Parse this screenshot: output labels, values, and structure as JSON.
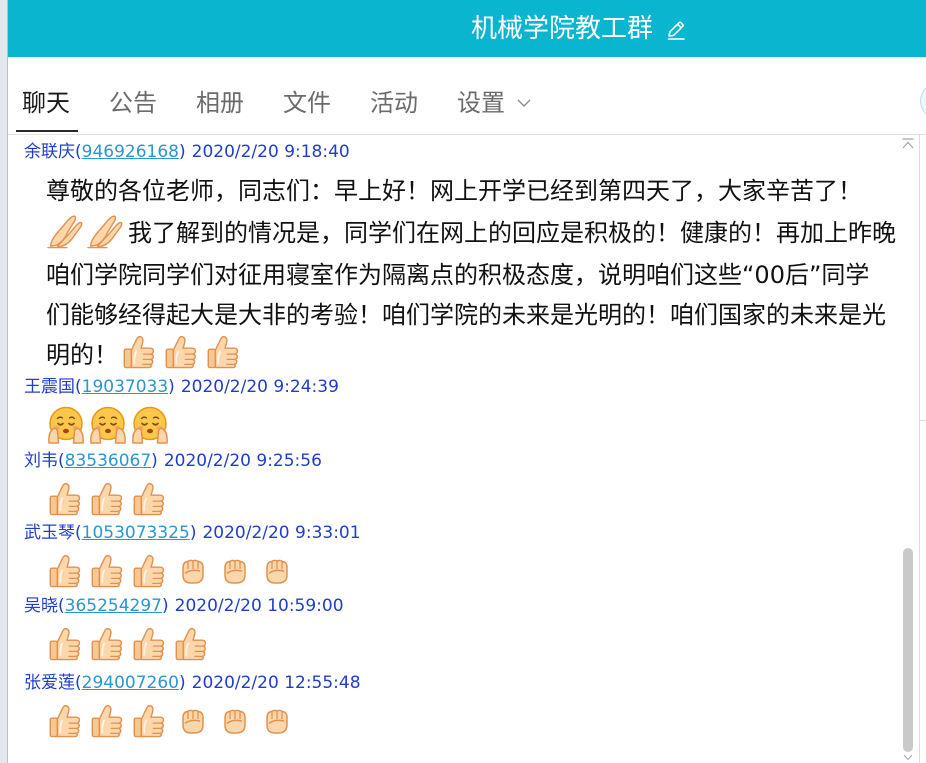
{
  "window": {
    "title": "机械学院教工群"
  },
  "icons": {
    "title_edit": "pencil-icon",
    "settings_menu": "chevron-down-icon",
    "panel_collapse": "collapse-up-icon",
    "scroll_down": "chevron-down-icon"
  },
  "colors": {
    "header_bg": "#0ab5cf",
    "name": "#1f3ecb",
    "qq_link": "#2b96d4",
    "message_text": "#111111",
    "tab_active": "#1a1a1a",
    "tab_inactive": "#6b6b6b",
    "scroll_thumb": "#c9c9c9"
  },
  "tabs": [
    {
      "label": "聊天",
      "active": true
    },
    {
      "label": "公告"
    },
    {
      "label": "相册"
    },
    {
      "label": "文件"
    },
    {
      "label": "活动"
    },
    {
      "label": "设置",
      "has_dropdown": true
    }
  ],
  "messages": [
    {
      "sender": "余联庆",
      "qq": "946926168",
      "time": "2020/2/20 9:18:40",
      "lines": [
        {
          "text": "尊敬的各位老师，同志们：早上好！网上开学已经到第四天了，大家辛苦了！"
        },
        {
          "emoji_before": [
            "pray-hands",
            "pray-hands"
          ],
          "text": "我了解到的情况是，同学们在网上的回应是积极的！健康的！再加上昨晚"
        },
        {
          "text": "咱们学院同学们对征用寝室作为隔离点的积极态度，说明咱们这些“00后”同学"
        },
        {
          "text": "们能够经得起大是大非的考验！咱们学院的未来是光明的！咱们国家的未来是光"
        },
        {
          "text": "明的！",
          "emoji_after": [
            "thumbs-up",
            "thumbs-up",
            "thumbs-up"
          ]
        }
      ]
    },
    {
      "sender": "王震国",
      "qq": "19037033",
      "time": "2020/2/20 9:24:39",
      "emojis": [
        "face-hands",
        "face-hands",
        "face-hands"
      ]
    },
    {
      "sender": "刘韦",
      "qq": "83536067",
      "time": "2020/2/20 9:25:56",
      "emojis": [
        "thumbs-up",
        "thumbs-up",
        "thumbs-up"
      ]
    },
    {
      "sender": "武玉琴",
      "qq": "1053073325",
      "time": "2020/2/20 9:33:01",
      "emojis": [
        "thumbs-up",
        "thumbs-up",
        "thumbs-up",
        "fist",
        "fist",
        "fist"
      ]
    },
    {
      "sender": "吴晓",
      "qq": "365254297",
      "time": "2020/2/20 10:59:00",
      "emojis": [
        "thumbs-up",
        "thumbs-up",
        "thumbs-up",
        "thumbs-up"
      ]
    },
    {
      "sender": "张爱莲",
      "qq": "294007260",
      "time": "2020/2/20 12:55:48",
      "emojis": [
        "thumbs-up",
        "thumbs-up",
        "thumbs-up",
        "fist",
        "fist",
        "fist"
      ]
    }
  ]
}
